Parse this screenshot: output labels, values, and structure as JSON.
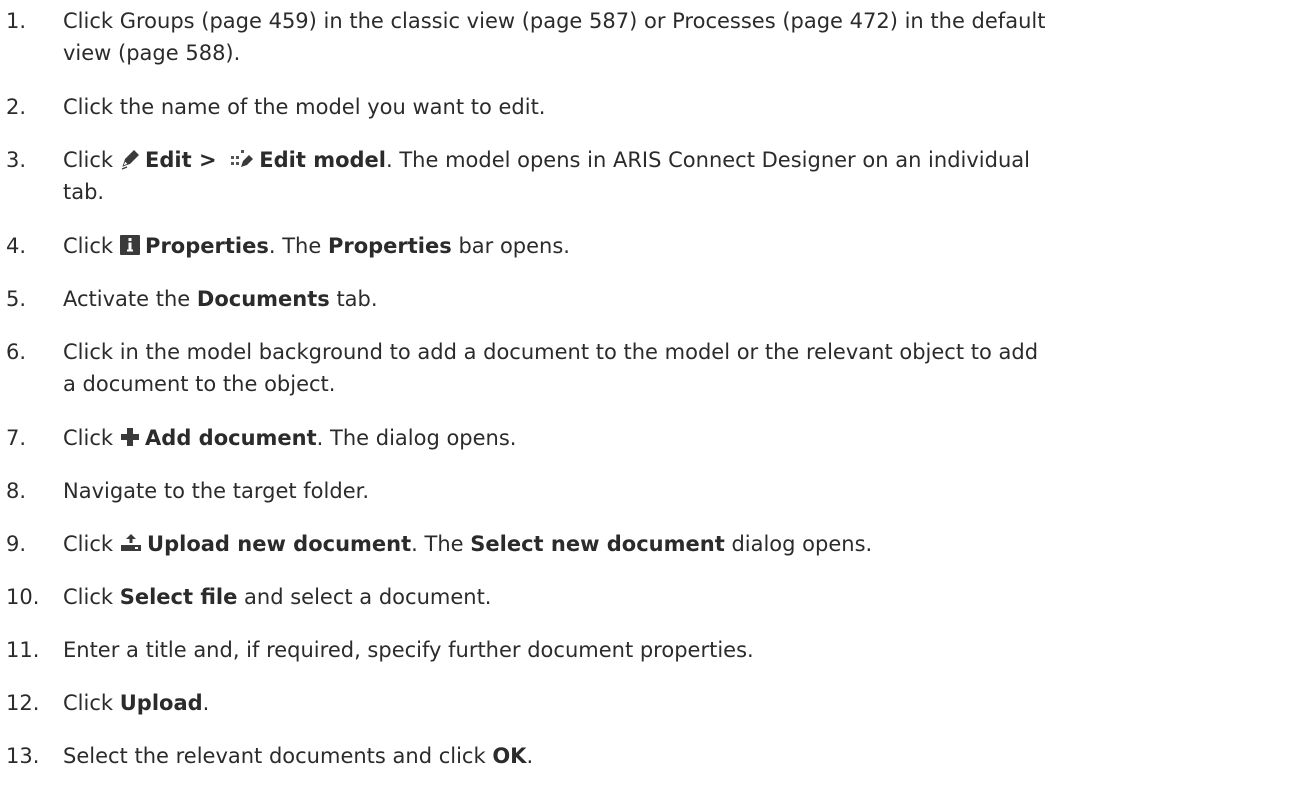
{
  "steps": [
    {
      "number": "1.",
      "line1": "Click Groups (page 459) in the classic view (page 587) or Processes (page 472) in the default",
      "line2": "view (page 588)."
    },
    {
      "number": "2.",
      "text": "Click the name of the model you want to edit."
    },
    {
      "number": "3.",
      "pre": "Click",
      "icon1": "pencil-icon",
      "bold1": "Edit >",
      "icon2": "edit-model-icon",
      "bold2": "Edit model",
      "post": ". The model opens in ARIS Connect Designer on an individual",
      "line2": "tab."
    },
    {
      "number": "4.",
      "pre": "Click",
      "icon": "info-icon",
      "bold1": "Properties",
      "mid": ". The",
      "bold2": "Properties",
      "post": "bar opens."
    },
    {
      "number": "5.",
      "pre": "Activate the",
      "bold": "Documents",
      "post": "tab."
    },
    {
      "number": "6.",
      "line1": "Click in the model background to add a document to the model or the relevant object to add",
      "line2": "a document to the object."
    },
    {
      "number": "7.",
      "pre": "Click",
      "icon": "plus-icon",
      "bold": "Add document",
      "post": ". The dialog opens."
    },
    {
      "number": "8.",
      "text": "Navigate to the target folder."
    },
    {
      "number": "9.",
      "pre": "Click",
      "icon": "upload-icon",
      "bold1": "Upload new document",
      "mid": ". The",
      "bold2": "Select new document",
      "post": "dialog opens."
    },
    {
      "number": "10.",
      "pre": "Click",
      "bold": "Select file",
      "post": "and select a document."
    },
    {
      "number": "11.",
      "text": "Enter a title and, if required, specify further document properties."
    },
    {
      "number": "12.",
      "pre": "Click",
      "bold": "Upload",
      "post": "."
    },
    {
      "number": "13.",
      "pre": "Select the relevant documents and click",
      "bold": "OK",
      "post": "."
    }
  ]
}
